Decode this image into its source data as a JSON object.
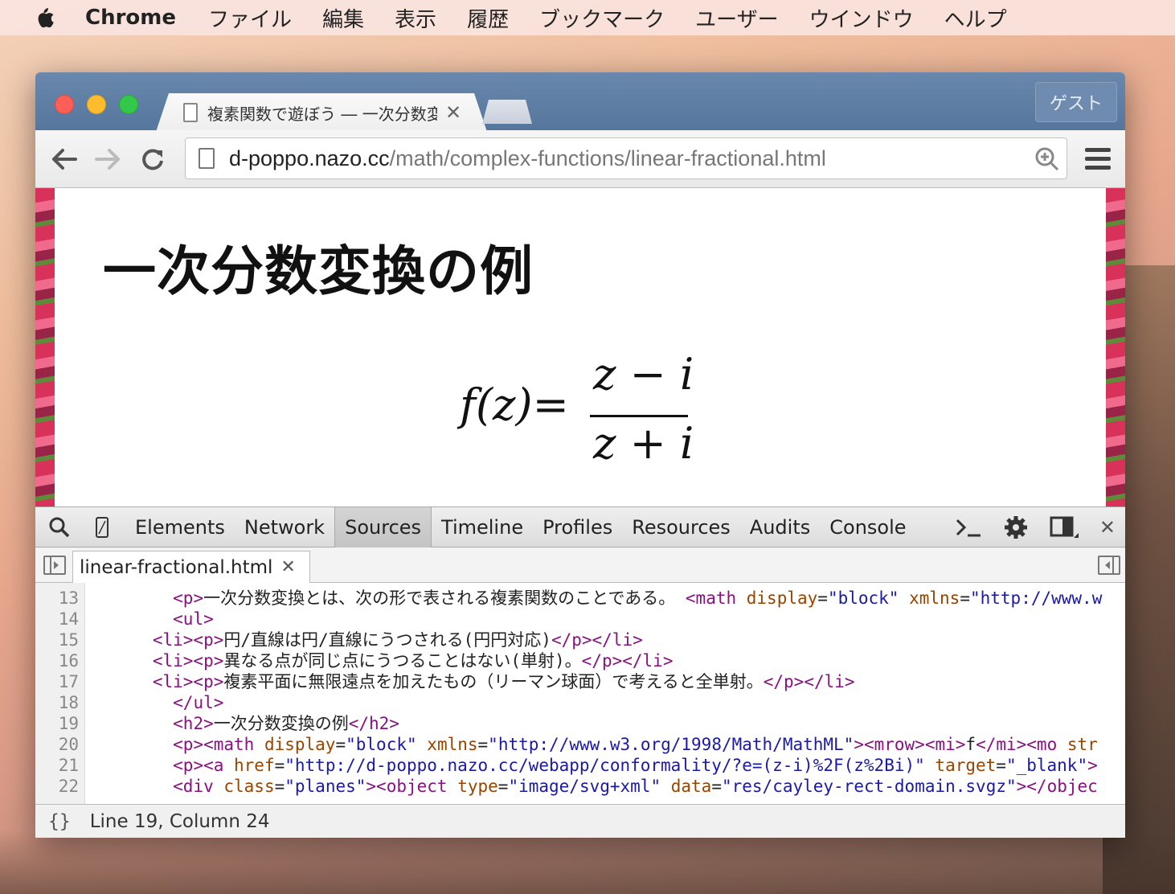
{
  "menubar": {
    "app": "Chrome",
    "items": [
      "ファイル",
      "編集",
      "表示",
      "履歴",
      "ブックマーク",
      "ユーザー",
      "ウインドウ",
      "ヘルプ"
    ]
  },
  "browser": {
    "tab_title": "複素関数で遊ぼう ― 一次分数変換",
    "guest_label": "ゲスト",
    "url_host": "d-poppo.nazo.cc",
    "url_path": "/math/complex-functions/linear-fractional.html"
  },
  "page": {
    "heading": "一次分数変換の例",
    "formula": {
      "lhs": "f(z)=",
      "numerator": "z − i",
      "denominator": "z + i"
    }
  },
  "devtools": {
    "tabs": [
      "Elements",
      "Network",
      "Sources",
      "Timeline",
      "Profiles",
      "Resources",
      "Audits",
      "Console"
    ],
    "active_tab": "Sources",
    "open_file": "linear-fractional.html",
    "lines": [
      {
        "n": "13",
        "indent": "    ",
        "parts": [
          [
            "t",
            "<p>"
          ],
          [
            "x",
            "一次分数変換とは、次の形で表される複素関数のことである。 "
          ],
          [
            "t",
            "<math "
          ],
          [
            "a",
            "display"
          ],
          [
            "x",
            "="
          ],
          [
            "v",
            "\"block\""
          ],
          [
            "x",
            " "
          ],
          [
            "a",
            "xmlns"
          ],
          [
            "x",
            "="
          ],
          [
            "v",
            "\"http://www.w"
          ]
        ]
      },
      {
        "n": "14",
        "indent": "    ",
        "parts": [
          [
            "t",
            "<ul>"
          ]
        ]
      },
      {
        "n": "15",
        "indent": "  ",
        "parts": [
          [
            "t",
            "<li><p>"
          ],
          [
            "x",
            "円/直線は円/直線にうつされる(円円対応)"
          ],
          [
            "t",
            "</p></li>"
          ]
        ]
      },
      {
        "n": "16",
        "indent": "  ",
        "parts": [
          [
            "t",
            "<li><p>"
          ],
          [
            "x",
            "異なる点が同じ点にうつることはない(単射)。"
          ],
          [
            "t",
            "</p></li>"
          ]
        ]
      },
      {
        "n": "17",
        "indent": "  ",
        "parts": [
          [
            "t",
            "<li><p>"
          ],
          [
            "x",
            "複素平面に無限遠点を加えたもの（リーマン球面）で考えると全単射。"
          ],
          [
            "t",
            "</p></li>"
          ]
        ]
      },
      {
        "n": "18",
        "indent": "    ",
        "parts": [
          [
            "t",
            "</ul>"
          ]
        ]
      },
      {
        "n": "19",
        "indent": "    ",
        "parts": [
          [
            "t",
            "<h2>"
          ],
          [
            "x",
            "一次分数変換の例"
          ],
          [
            "t",
            "</h2>"
          ]
        ]
      },
      {
        "n": "20",
        "indent": "    ",
        "parts": [
          [
            "t",
            "<p><math "
          ],
          [
            "a",
            "display"
          ],
          [
            "x",
            "="
          ],
          [
            "v",
            "\"block\""
          ],
          [
            "x",
            " "
          ],
          [
            "a",
            "xmlns"
          ],
          [
            "x",
            "="
          ],
          [
            "v",
            "\"http://www.w3.org/1998/Math/MathML\""
          ],
          [
            "t",
            "><mrow><mi>"
          ],
          [
            "x",
            "f"
          ],
          [
            "t",
            "</mi><mo "
          ],
          [
            "a",
            "str"
          ]
        ]
      },
      {
        "n": "21",
        "indent": "    ",
        "parts": [
          [
            "t",
            "<p><a "
          ],
          [
            "a",
            "href"
          ],
          [
            "x",
            "="
          ],
          [
            "v",
            "\"http://d-poppo.nazo.cc/webapp/conformality/?e=(z-i)%2F(z%2Bi)\""
          ],
          [
            "x",
            " "
          ],
          [
            "a",
            "target"
          ],
          [
            "x",
            "="
          ],
          [
            "v",
            "\"_blank\""
          ],
          [
            "t",
            ">"
          ]
        ]
      },
      {
        "n": "22",
        "indent": "    ",
        "parts": [
          [
            "t",
            "<div "
          ],
          [
            "a",
            "class"
          ],
          [
            "x",
            "="
          ],
          [
            "v",
            "\"planes\""
          ],
          [
            "t",
            "><object "
          ],
          [
            "a",
            "type"
          ],
          [
            "x",
            "="
          ],
          [
            "v",
            "\"image/svg+xml\""
          ],
          [
            "x",
            " "
          ],
          [
            "a",
            "data"
          ],
          [
            "x",
            "="
          ],
          [
            "v",
            "\"res/cayley-rect-domain.svgz\""
          ],
          [
            "t",
            "></objec"
          ]
        ]
      }
    ],
    "status": "Line 19, Column 24"
  }
}
